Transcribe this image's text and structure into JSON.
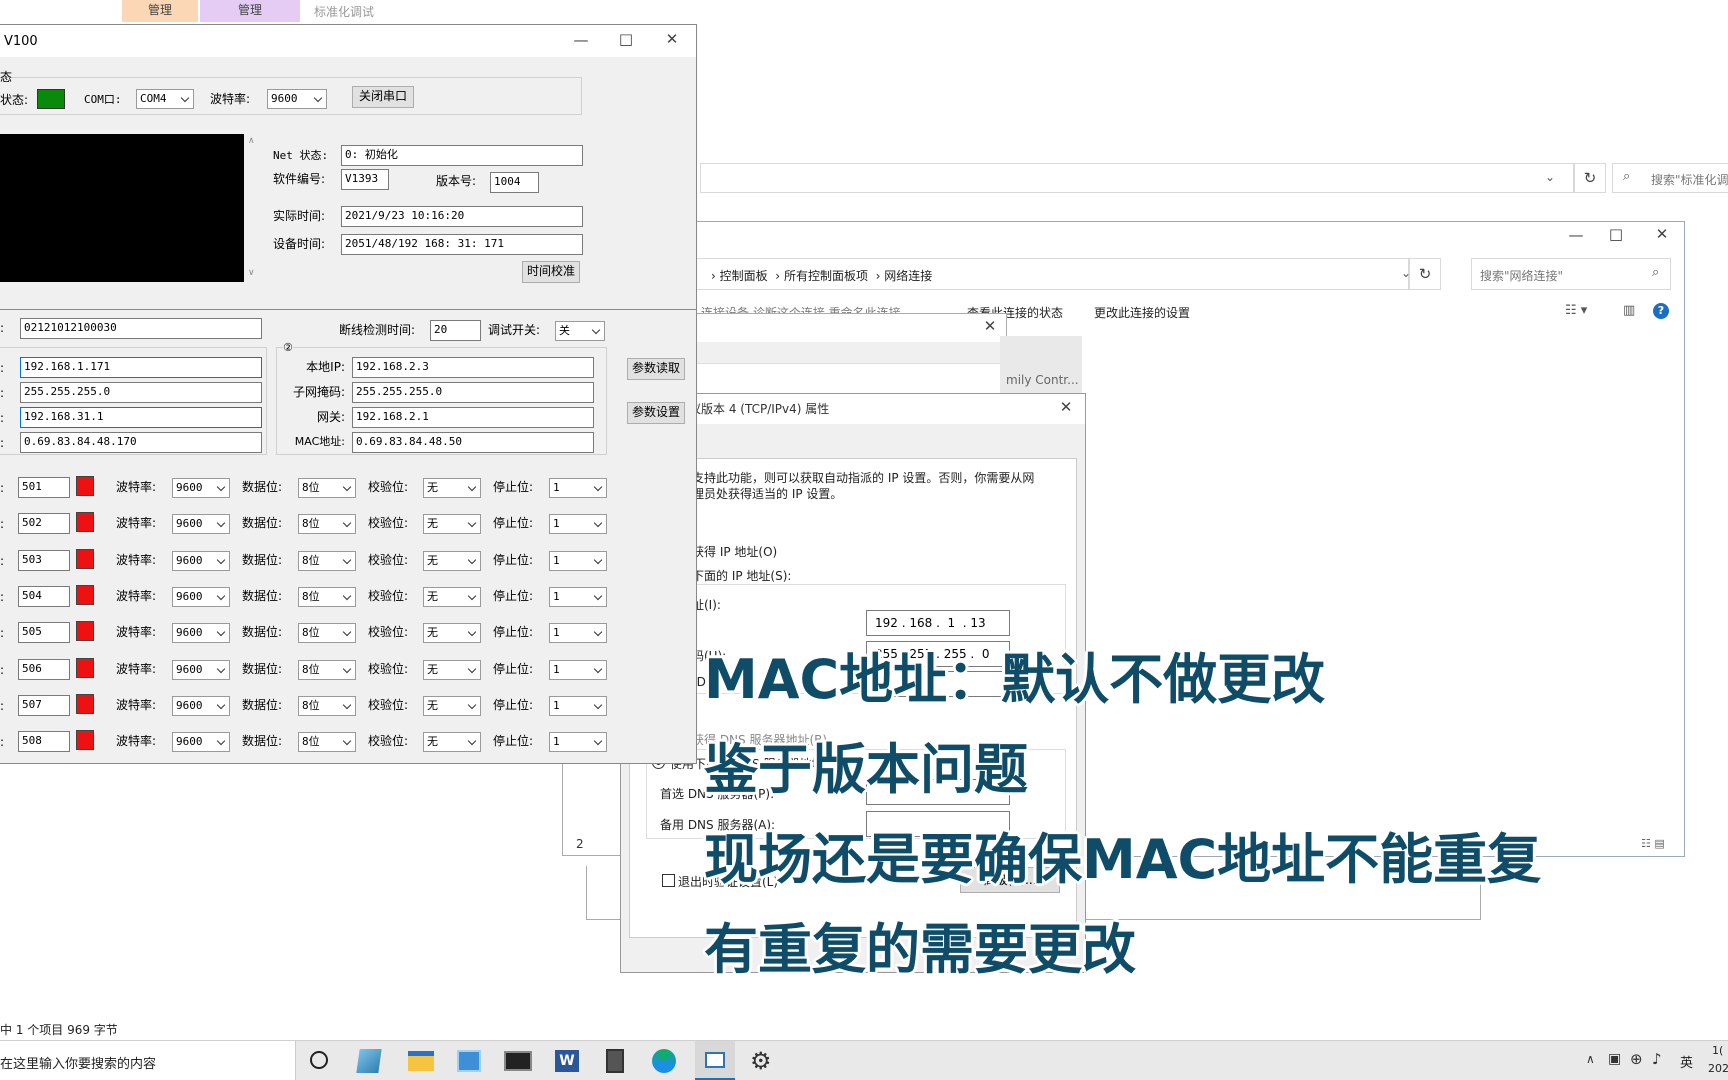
{
  "explorer_bg": {
    "ribbon_tabs": [
      "管理",
      "管理",
      "标准化调试"
    ],
    "search_placeholder": "搜索\"标准化调",
    "status_text": "中 1 个项目  969 字节"
  },
  "netconn": {
    "breadcrumb": [
      "控制面板",
      "所有控制面板项",
      "网络连接"
    ],
    "search_placeholder": "搜索\"网络连接\"",
    "toolbar": [
      "查看此连接的状态",
      "更改此连接的设置"
    ],
    "partial_toolbar": "连接设备 诊断这个连接 重命名此连接",
    "adapter_partial": "mily Contr...",
    "side_num": "2"
  },
  "ipv4": {
    "title": "议版本 4 (TCP/IPv4) 属性",
    "desc1": "支持此功能，则可以获取自动指派的 IP 设置。否则，你需要从网",
    "desc2": "理员处获得适当的 IP 设置。",
    "auto_ip": "获得 IP 地址(O)",
    "manual_ip": "下面的 IP 地址(S):",
    "ip_label": "址(I):",
    "ip_value": "192 . 168 .  1  . 13",
    "mask_label": "码(U):",
    "mask_value": "255 . 255 . 255 .  0",
    "gw_label": "(D):",
    "auto_dns": "获得 DNS 服务器地址(B)",
    "manual_dns": "使用下面的 DNS 服务器地址(E):",
    "pref_dns": "首选 DNS 服务器(P):",
    "alt_dns": "备用 DNS 服务器(A):",
    "validate": "退出时验证设置(L)",
    "advanced": "高级(V)..."
  },
  "app": {
    "title": "V100",
    "status_group": "态",
    "status_label": "状态:",
    "status_color": "#0a8a0a",
    "com_label": "COM口:",
    "com_value": "COM4",
    "baud_label": "波特率:",
    "baud_value": "9600",
    "close_port": "关闭串口",
    "net_status_label": "Net 状态:",
    "net_status": "0: 初始化",
    "sw_label": "软件编号:",
    "sw_value": "V1393",
    "ver_label": "版本号:",
    "ver_value": "1004",
    "real_time_label": "实际时间:",
    "real_time": "2021/9/23 10:16:20",
    "dev_time_label": "设备时间:",
    "dev_time": "2051/48/192 168: 31: 171",
    "time_sync": "时间校准",
    "device_id": "02121012100030",
    "disconnect_label": "断线检测时间:",
    "disconnect_value": "20",
    "debug_label": "调试开关:",
    "debug_value": "关",
    "net2_marker": "②",
    "left_net": [
      "192.168.1.171",
      "255.255.255.0",
      "192.168.31.1",
      "0.69.83.84.48.170"
    ],
    "right_labels": [
      "本地IP:",
      "子网掩码:",
      "网关:",
      "MAC地址:"
    ],
    "right_net": [
      "192.168.2.3",
      "255.255.255.0",
      "192.168.2.1",
      "0.69.83.84.48.50"
    ],
    "read_params": "参数读取",
    "set_params": "参数设置",
    "ports": [
      {
        "port": "501",
        "baud": "9600",
        "data": "8位",
        "parity": "无",
        "stop": "1"
      },
      {
        "port": "502",
        "baud": "9600",
        "data": "8位",
        "parity": "无",
        "stop": "1"
      },
      {
        "port": "503",
        "baud": "9600",
        "data": "8位",
        "parity": "无",
        "stop": "1"
      },
      {
        "port": "504",
        "baud": "9600",
        "data": "8位",
        "parity": "无",
        "stop": "1"
      },
      {
        "port": "505",
        "baud": "9600",
        "data": "8位",
        "parity": "无",
        "stop": "1"
      },
      {
        "port": "506",
        "baud": "9600",
        "data": "8位",
        "parity": "无",
        "stop": "1"
      },
      {
        "port": "507",
        "baud": "9600",
        "data": "8位",
        "parity": "无",
        "stop": "1"
      },
      {
        "port": "508",
        "baud": "9600",
        "data": "8位",
        "parity": "无",
        "stop": "1"
      }
    ],
    "row_labels": {
      "baud": "波特率:",
      "data": "数据位:",
      "parity": "校验位:",
      "stop": "停止位:"
    }
  },
  "overlay": [
    "MAC地址：默认不做更改",
    "鉴于版本问题",
    "现场还是要确保MAC地址不能重复",
    "有重复的需要更改"
  ],
  "taskbar": {
    "search_text": "在这里输入你要搜索的内容",
    "tray_lang": "英",
    "clock_top": "1(",
    "clock_bottom": "202"
  }
}
